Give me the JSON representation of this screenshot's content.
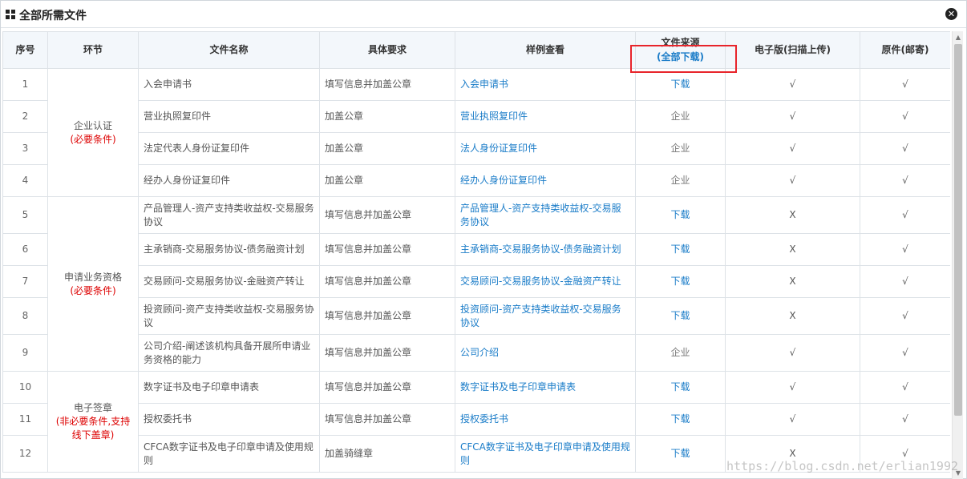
{
  "dialog": {
    "title": "全部所需文件",
    "close_icon": "close-icon"
  },
  "headers": {
    "seq": "序号",
    "stage": "环节",
    "name": "文件名称",
    "req": "具体要求",
    "sample": "样例查看",
    "source": "文件来源",
    "all_download": "(全部下载)",
    "electronic": "电子版(扫描上传)",
    "original": "原件(邮寄)"
  },
  "groups": [
    {
      "label": "企业认证",
      "note": "(必要条件)"
    },
    {
      "label": "申请业务资格",
      "note": "(必要条件)"
    },
    {
      "label": "电子签章",
      "note": "(非必要条件,支持线下盖章)"
    }
  ],
  "rows": [
    {
      "seq": "1",
      "name": "入会申请书",
      "req": "填写信息并加盖公章",
      "sample": "入会申请书",
      "source": "下载",
      "electronic": "√",
      "original": "√"
    },
    {
      "seq": "2",
      "name": "营业执照复印件",
      "req": "加盖公章",
      "sample": "营业执照复印件",
      "source": "企业",
      "electronic": "√",
      "original": "√"
    },
    {
      "seq": "3",
      "name": "法定代表人身份证复印件",
      "req": "加盖公章",
      "sample": "法人身份证复印件",
      "source": "企业",
      "electronic": "√",
      "original": "√"
    },
    {
      "seq": "4",
      "name": "经办人身份证复印件",
      "req": "加盖公章",
      "sample": "经办人身份证复印件",
      "source": "企业",
      "electronic": "√",
      "original": "√"
    },
    {
      "seq": "5",
      "name": "产品管理人-资产支持类收益权-交易服务协议",
      "req": "填写信息并加盖公章",
      "sample": "产品管理人-资产支持类收益权-交易服务协议",
      "source": "下载",
      "electronic": "X",
      "original": "√"
    },
    {
      "seq": "6",
      "name": "主承销商-交易服务协议-债务融资计划",
      "req": "填写信息并加盖公章",
      "sample": "主承销商-交易服务协议-债务融资计划",
      "source": "下载",
      "electronic": "X",
      "original": "√"
    },
    {
      "seq": "7",
      "name": "交易顾问-交易服务协议-金融资产转让",
      "req": "填写信息并加盖公章",
      "sample": "交易顾问-交易服务协议-金融资产转让",
      "source": "下载",
      "electronic": "X",
      "original": "√"
    },
    {
      "seq": "8",
      "name": "投资顾问-资产支持类收益权-交易服务协议",
      "req": "填写信息并加盖公章",
      "sample": "投资顾问-资产支持类收益权-交易服务协议",
      "source": "下载",
      "electronic": "X",
      "original": "√"
    },
    {
      "seq": "9",
      "name": "公司介绍-阐述该机构具备开展所申请业务资格的能力",
      "req": "填写信息并加盖公章",
      "sample": "公司介绍",
      "source": "企业",
      "electronic": "√",
      "original": "√"
    },
    {
      "seq": "10",
      "name": "数字证书及电子印章申请表",
      "req": "填写信息并加盖公章",
      "sample": "数字证书及电子印章申请表",
      "source": "下载",
      "electronic": "√",
      "original": "√"
    },
    {
      "seq": "11",
      "name": "授权委托书",
      "req": "填写信息并加盖公章",
      "sample": "授权委托书",
      "source": "下载",
      "electronic": "√",
      "original": "√"
    },
    {
      "seq": "12",
      "name": "CFCA数字证书及电子印章申请及使用规则",
      "req": "加盖骑缝章",
      "sample": "CFCA数字证书及电子印章申请及使用规则",
      "source": "下载",
      "electronic": "X",
      "original": "√"
    }
  ],
  "watermark": "https://blog.csdn.net/erlian1992",
  "colors": {
    "link": "#1a7cc8",
    "required": "#dd0000",
    "highlight": "#e8242b",
    "header_bg": "#f3f7fb"
  }
}
